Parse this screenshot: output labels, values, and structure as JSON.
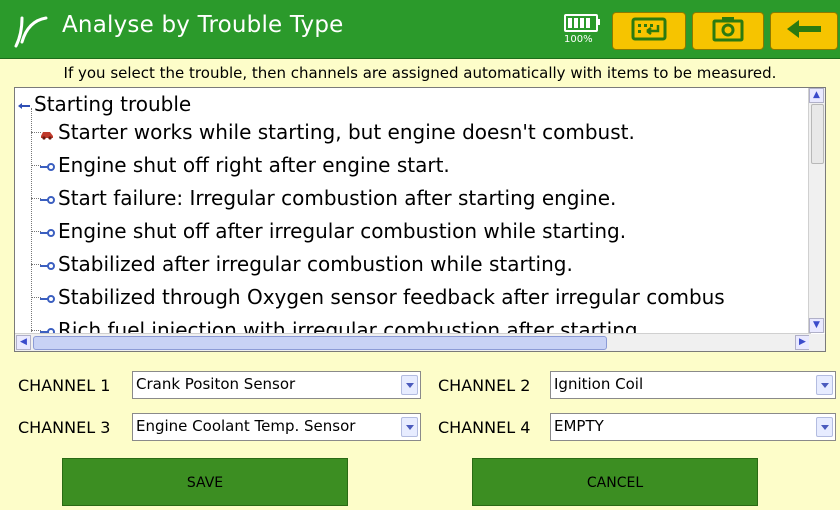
{
  "header": {
    "title": "Analyse by Trouble Type",
    "battery_percent": "100%",
    "accent_color": "#2b9a2b",
    "button_color": "#f6c400"
  },
  "instruction": "If you select the trouble, then channels are assigned automatically with items to be measured.",
  "tree": {
    "root": "Starting trouble",
    "items": [
      {
        "label": "Starter works while starting, but engine doesn't combust.",
        "icon": "car-icon-selected"
      },
      {
        "label": "Engine shut off right after engine start.",
        "icon": "wrench-icon"
      },
      {
        "label": "Start failure: Irregular combustion after starting engine.",
        "icon": "wrench-icon"
      },
      {
        "label": "Engine shut off after irregular combustion while starting.",
        "icon": "wrench-icon"
      },
      {
        "label": "Stabilized after irregular combustion while starting.",
        "icon": "wrench-icon"
      },
      {
        "label": "Stabilized through Oxygen sensor feedback after irregular combus",
        "icon": "wrench-icon"
      },
      {
        "label": "Rich fuel injection with irregular combustion after starting",
        "icon": "wrench-icon"
      }
    ]
  },
  "channels": [
    {
      "label": "CHANNEL 1",
      "value": "Crank Positon Sensor"
    },
    {
      "label": "CHANNEL 2",
      "value": "Ignition Coil"
    },
    {
      "label": "CHANNEL 3",
      "value": "Engine Coolant Temp. Sensor"
    },
    {
      "label": "CHANNEL 4",
      "value": "EMPTY"
    }
  ],
  "buttons": {
    "save": "SAVE",
    "cancel": "CANCEL"
  }
}
